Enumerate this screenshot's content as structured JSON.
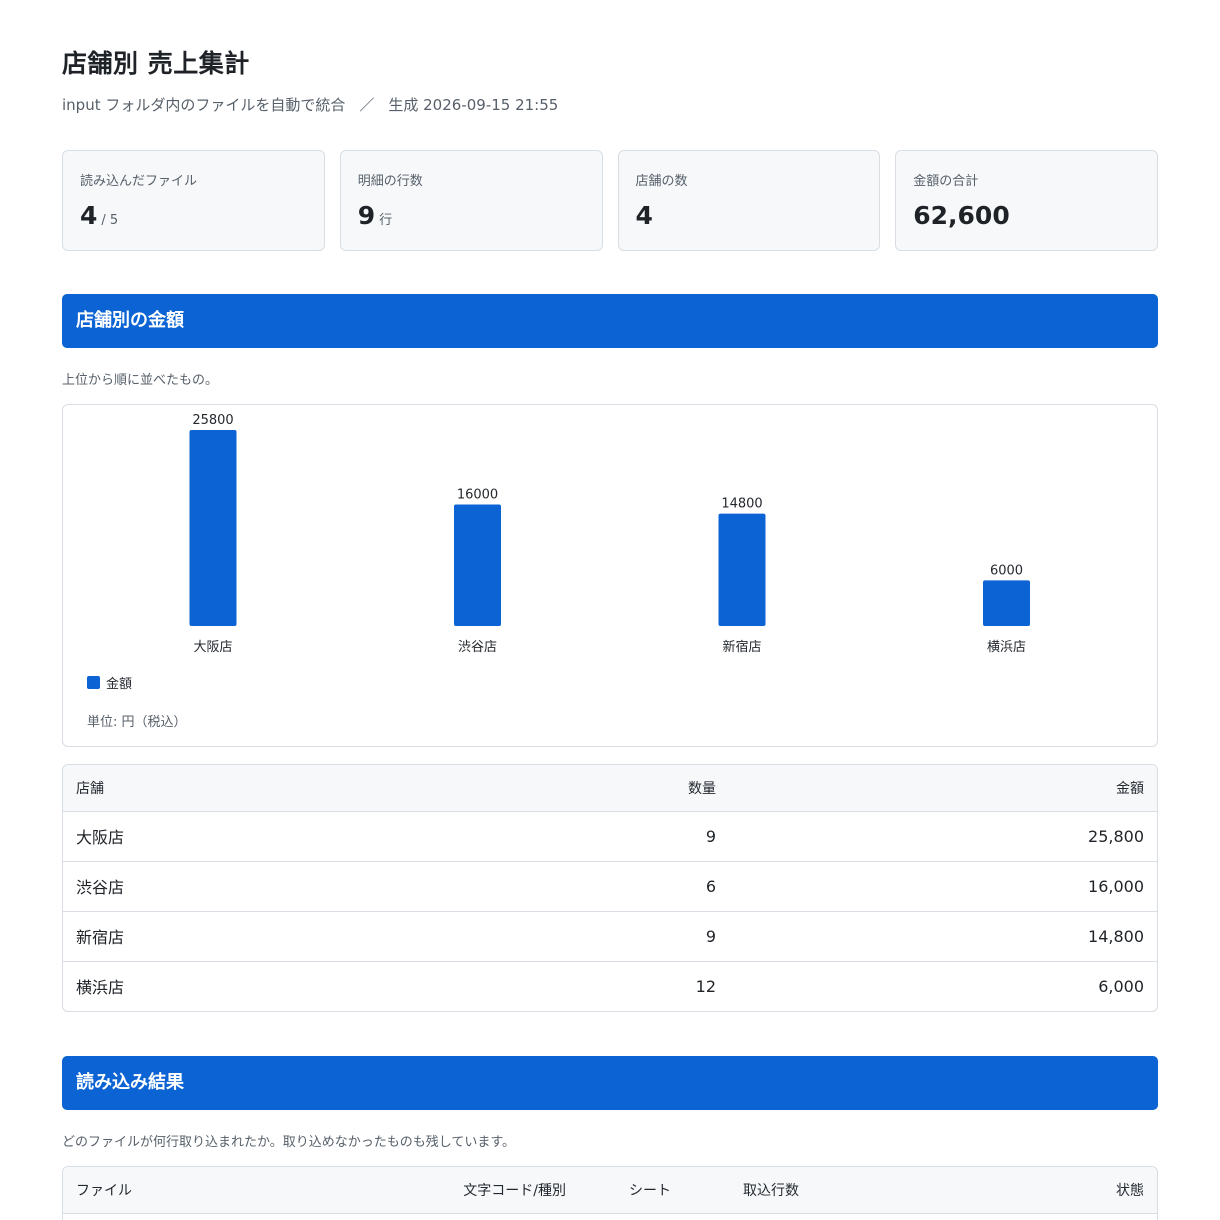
{
  "header": {
    "title": "店舗別 売上集計",
    "subtitle_source": "input フォルダ内のファイルを自動で統合",
    "subtitle_sep": "／",
    "subtitle_generated": "生成 2026-09-15 21:55"
  },
  "cards": [
    {
      "label": "読み込んだファイル",
      "value": "4",
      "unit": "/ 5"
    },
    {
      "label": "明細の行数",
      "value": "9",
      "unit": "行"
    },
    {
      "label": "店舗の数",
      "value": "4",
      "unit": ""
    },
    {
      "label": "金額の合計",
      "value": "62,600",
      "unit": ""
    }
  ],
  "section_store": {
    "title": "店舗別の金額",
    "note": "上位から順に並べたもの。",
    "legend_label": "金額",
    "unit_note": "単位: 円（税込）"
  },
  "chart_data": {
    "type": "bar",
    "categories": [
      "大阪店",
      "渋谷店",
      "新宿店",
      "横浜店"
    ],
    "series": [
      {
        "name": "金額",
        "values": [
          25800,
          16000,
          14800,
          6000
        ]
      }
    ],
    "ylim": [
      0,
      25800
    ],
    "color": "#0c63d4"
  },
  "store_table": {
    "headers": [
      "店舗",
      "数量",
      "金額"
    ],
    "rows": [
      [
        "大阪店",
        "9",
        "25,800"
      ],
      [
        "渋谷店",
        "6",
        "16,000"
      ],
      [
        "新宿店",
        "9",
        "14,800"
      ],
      [
        "横浜店",
        "12",
        "6,000"
      ]
    ]
  },
  "section_load": {
    "title": "読み込み結果",
    "note": "どのファイルが何行取り込まれたか。取り込めなかったものも残しています。"
  },
  "load_table": {
    "headers": [
      "ファイル",
      "文字コード/種別",
      "シート",
      "取込行数",
      "状態"
    ]
  },
  "colors": {
    "accent": "#0c63d4",
    "card_bg": "#f6f8fa",
    "border": "#d8dee4"
  }
}
